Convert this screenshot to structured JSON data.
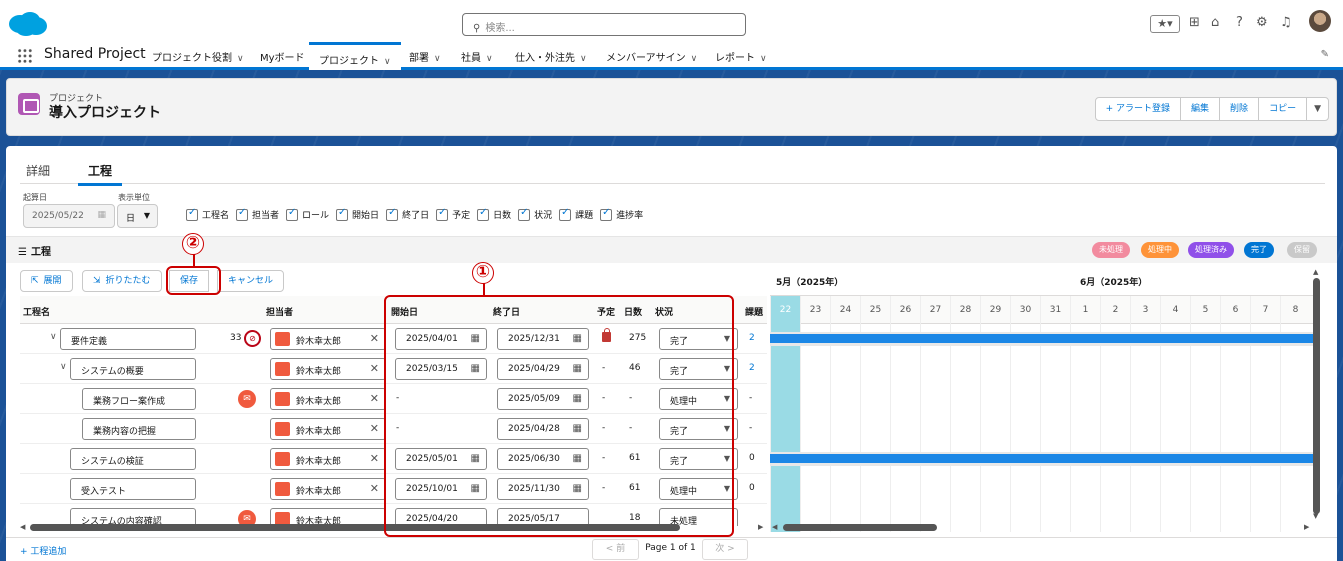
{
  "header": {
    "search_placeholder": "検索...",
    "app_name": "Shared Project",
    "nav": [
      {
        "label": "プロジェクト役割"
      },
      {
        "label": "Myボード"
      },
      {
        "label": "プロジェクト"
      },
      {
        "label": "部署"
      },
      {
        "label": "社員"
      },
      {
        "label": "仕入・外注先"
      },
      {
        "label": "メンバーアサイン"
      },
      {
        "label": "レポート"
      }
    ]
  },
  "record": {
    "object_label": "プロジェクト",
    "title": "導入プロジェクト",
    "actions": {
      "alert": "+ アラート登録",
      "edit": "編集",
      "delete": "削除",
      "copy": "コピー"
    }
  },
  "tabs": {
    "detail": "詳細",
    "process": "工程"
  },
  "filters": {
    "start_label": "起算日",
    "start_value": "2025/05/22",
    "unit_label": "表示単位",
    "unit_value": "日",
    "columns": [
      "工程名",
      "担当者",
      "ロール",
      "開始日",
      "終了日",
      "予定",
      "日数",
      "状況",
      "課題",
      "進捗率"
    ]
  },
  "section": {
    "title": "工程",
    "legend": [
      {
        "label": "未処理",
        "color": "#f28b9f"
      },
      {
        "label": "処理中",
        "color": "#fe9339"
      },
      {
        "label": "処理済み",
        "color": "#9050e9"
      },
      {
        "label": "完了",
        "color": "#0176d3"
      },
      {
        "label": "保留",
        "color": "#c9c9c9"
      }
    ]
  },
  "toolbar": {
    "expand": "展開",
    "collapse": "折りたたむ",
    "save": "保存",
    "cancel": "キャンセル"
  },
  "table": {
    "headers": {
      "name": "工程名",
      "owner": "担当者",
      "start": "開始日",
      "end": "終了日",
      "plan": "予定",
      "days": "日数",
      "status": "状況",
      "issues": "課題"
    },
    "rows": [
      {
        "name": "要件定義",
        "progress": "33",
        "owner": "鈴木幸太郎",
        "start": "2025/04/01",
        "end": "2025/12/31",
        "plan": "",
        "days": "275",
        "status": "完了",
        "issues": "2"
      },
      {
        "name": "システムの概要",
        "owner": "鈴木幸太郎",
        "start": "2025/03/15",
        "end": "2025/04/29",
        "plan": "-",
        "days": "46",
        "status": "完了",
        "issues": "2"
      },
      {
        "name": "業務フロー案作成",
        "owner": "鈴木幸太郎",
        "start": "-",
        "end": "2025/05/09",
        "plan": "-",
        "days": "-",
        "status": "処理中",
        "issues": "-"
      },
      {
        "name": "業務内容の把握",
        "owner": "鈴木幸太郎",
        "start": "-",
        "end": "2025/04/28",
        "plan": "-",
        "days": "-",
        "status": "完了",
        "issues": "-"
      },
      {
        "name": "システムの検証",
        "owner": "鈴木幸太郎",
        "start": "2025/05/01",
        "end": "2025/06/30",
        "plan": "-",
        "days": "61",
        "status": "完了",
        "issues": "0"
      },
      {
        "name": "受入テスト",
        "owner": "鈴木幸太郎",
        "start": "2025/10/01",
        "end": "2025/11/30",
        "plan": "-",
        "days": "61",
        "status": "処理中",
        "issues": "0"
      },
      {
        "name": "システムの内容確認",
        "owner": "鈴木幸太郎",
        "start": "2025/04/20",
        "end": "2025/05/17",
        "plan": "-",
        "days": "18",
        "status": "未処理",
        "issues": "-"
      }
    ]
  },
  "gantt": {
    "month1": "5月（2025年）",
    "month2": "6月（2025年）",
    "days": [
      "22",
      "23",
      "24",
      "25",
      "26",
      "27",
      "28",
      "29",
      "30",
      "31",
      "1",
      "2",
      "3",
      "4",
      "5",
      "6",
      "7",
      "8"
    ]
  },
  "footer": {
    "add": "+ 工程追加",
    "prev": "< 前",
    "page": "Page 1 of 1",
    "next": "次 >"
  },
  "annotations": {
    "one": "①",
    "two": "②"
  }
}
